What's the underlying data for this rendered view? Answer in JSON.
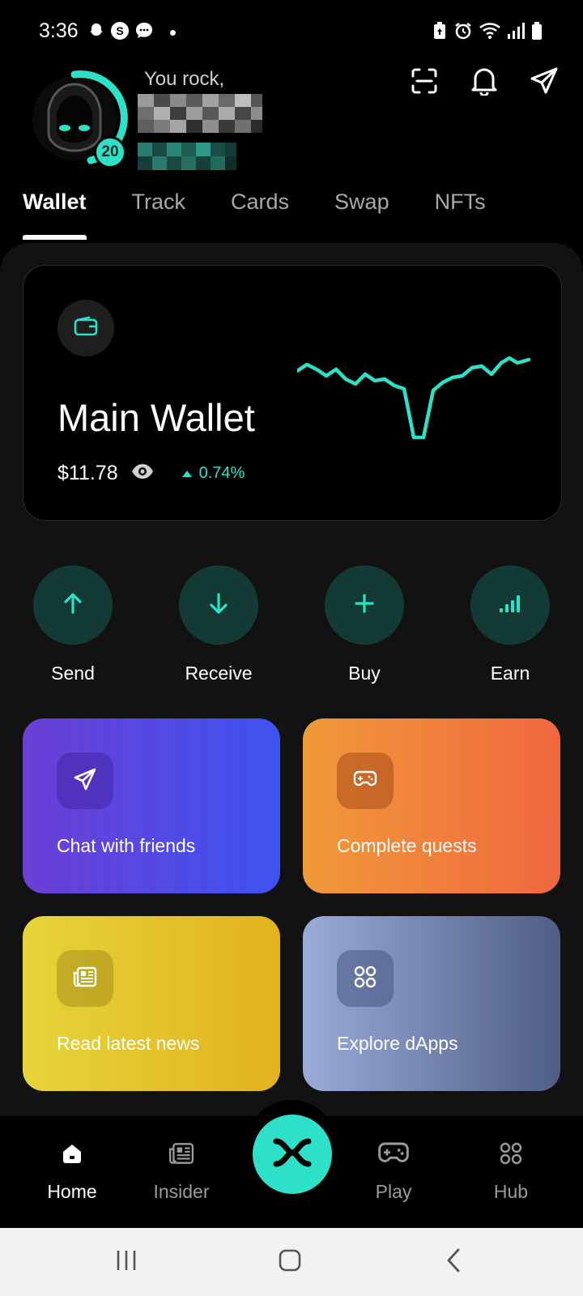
{
  "status_bar": {
    "time": "3:36"
  },
  "header": {
    "greeting": "You rock,",
    "level_badge": "20"
  },
  "tabs": [
    {
      "label": "Wallet",
      "active": true
    },
    {
      "label": "Track",
      "active": false
    },
    {
      "label": "Cards",
      "active": false
    },
    {
      "label": "Swap",
      "active": false
    },
    {
      "label": "NFTs",
      "active": false
    }
  ],
  "wallet": {
    "title": "Main Wallet",
    "balance": "$11.78",
    "change": "0.74%",
    "trend": "up"
  },
  "actions": [
    {
      "label": "Send",
      "icon": "arrow-up-icon"
    },
    {
      "label": "Receive",
      "icon": "arrow-down-icon"
    },
    {
      "label": "Buy",
      "icon": "plus-icon"
    },
    {
      "label": "Earn",
      "icon": "bars-icon"
    }
  ],
  "promos": {
    "chat": "Chat with friends",
    "quests": "Complete quests",
    "news": "Read latest news",
    "dapps": "Explore dApps"
  },
  "bottom_nav": {
    "home": "Home",
    "insider": "Insider",
    "play": "Play",
    "hub": "Hub"
  },
  "colors": {
    "accent": "#2de1c8",
    "background": "#000000",
    "panel": "#121212"
  }
}
